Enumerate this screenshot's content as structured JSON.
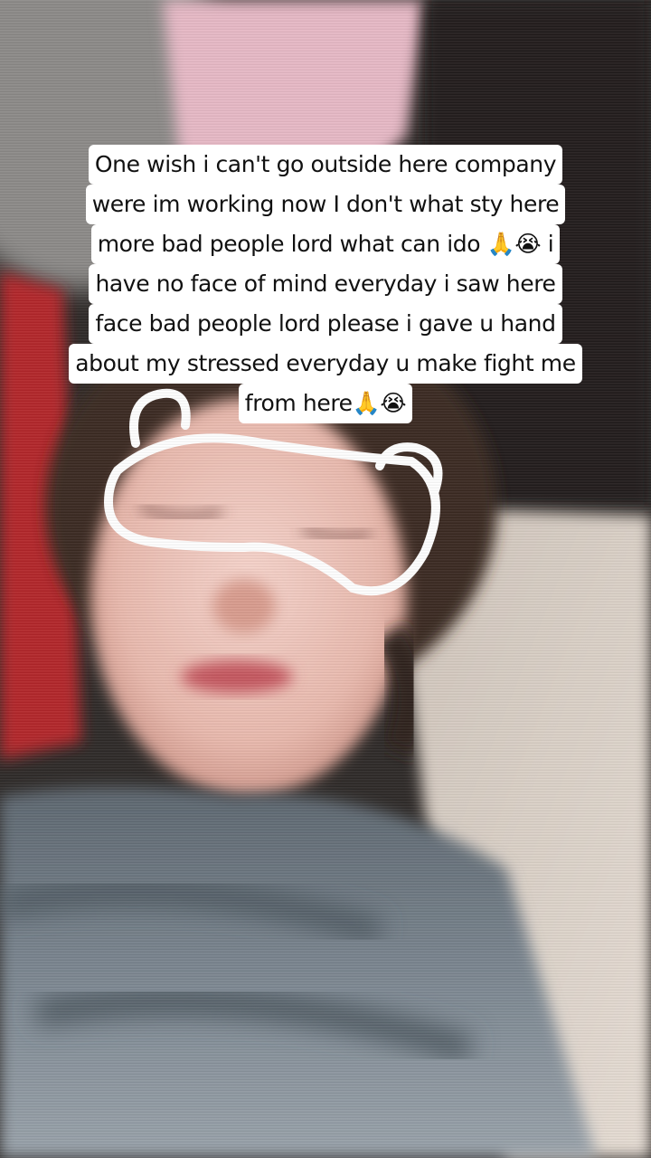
{
  "caption": {
    "lines": [
      "One wish i can't go outside here company",
      "were im working now I don't what sty here",
      "more bad people lord what can ido 🙏😭 i",
      "have no face of mind everyday i saw here",
      "face bad people lord please i gave u hand",
      "about my stressed everyday u make fight me",
      "from here🙏😭"
    ],
    "background_color": "#ffffff",
    "text_color": "#111111"
  },
  "photo": {
    "filter": "bear-ear sleep mask outline",
    "mask_color": "#ffffff",
    "blanket_color": "#6f7a84",
    "pillow_color": "#d8cfc6",
    "accent_red": "#b3262a"
  }
}
